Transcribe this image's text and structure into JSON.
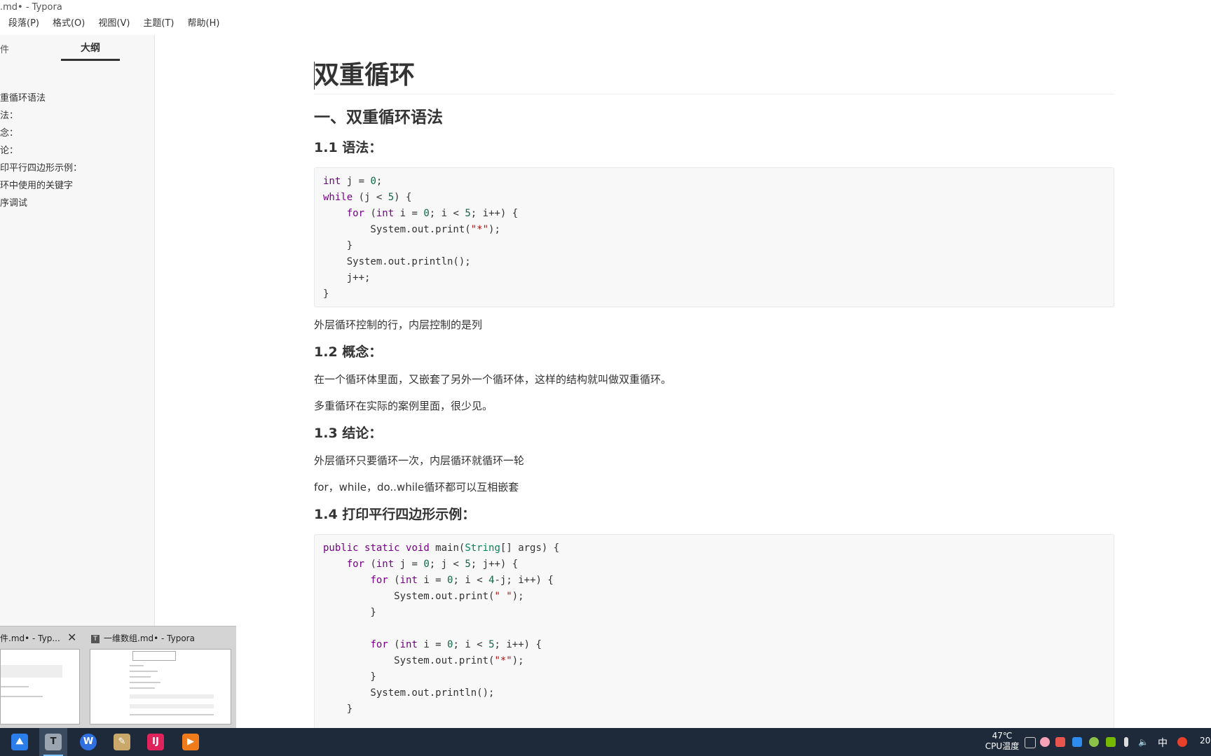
{
  "window": {
    "title": ".md• - Typora"
  },
  "menu": [
    "段落(P)",
    "格式(O)",
    "视图(V)",
    "主题(T)",
    "帮助(H)"
  ],
  "sidebar": {
    "tab_file": "件",
    "tab_outline": "大纲",
    "outline": [
      "重循环语法",
      "法：",
      "念：",
      "论：",
      "印平行四边形示例：",
      "环中使用的关键字",
      "序调试"
    ]
  },
  "doc": {
    "h1": "双重循环",
    "h2_1": "一、双重循环语法",
    "h3_1": "1.1 语法：",
    "code1": [
      "int j = 0;",
      "while (j < 5) {",
      "    for (int i = 0; i < 5; i++) {",
      "        System.out.print(\"*\");",
      "    }",
      "    System.out.println();",
      "    j++;",
      "}"
    ],
    "p1": "外层循环控制的行，内层控制的是列",
    "h3_2": "1.2 概念：",
    "p2": "在一个循环体里面，又嵌套了另外一个循环体，这样的结构就叫做双重循环。",
    "p3": "多重循环在实际的案例里面，很少见。",
    "h3_3": "1.3 结论：",
    "p4": "外层循环只要循环一次，内层循环就循环一轮",
    "p5": "for，while，do..while循环都可以互相嵌套",
    "h3_4": "1.4 打印平行四边形示例：",
    "code2": [
      "public static void main(String[] args) {",
      "    for (int j = 0; j < 5; j++) {",
      "        for (int i = 0; i < 4-j; i++) {",
      "            System.out.print(\" \");",
      "        }",
      "",
      "        for (int i = 0; i < 5; i++) {",
      "            System.out.print(\"*\");",
      "        }",
      "        System.out.println();",
      "    }"
    ]
  },
  "preview": {
    "thumb1_title": "件.md• - Typ...",
    "thumb2_title": "一维数组.md• - Typora"
  },
  "taskbar": {
    "temp": "47℃",
    "temp_label": "CPU温度",
    "ime": "中",
    "clock": "20"
  },
  "colors": {
    "keyword": "#770088",
    "type": "#008855",
    "number": "#116644",
    "string": "#aa1111",
    "taskbar": "#1e2a3a"
  }
}
